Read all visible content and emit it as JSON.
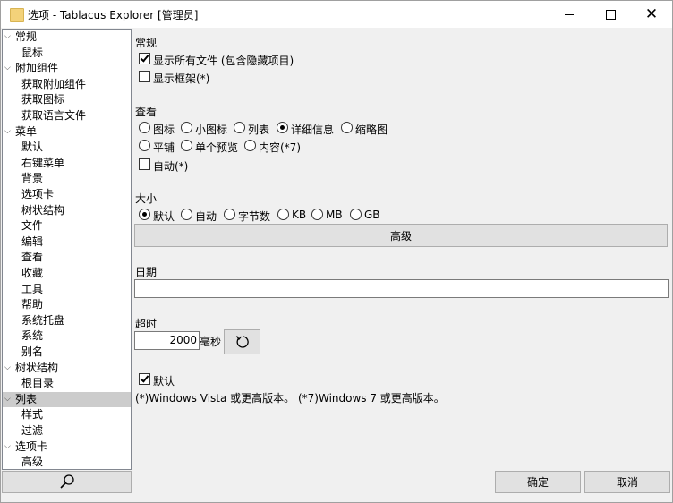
{
  "window": {
    "title": "选项 - Tablacus Explorer [管理员]"
  },
  "tree": {
    "items": [
      {
        "label": "常规",
        "level": 0,
        "expander": "⌵",
        "selected": false
      },
      {
        "label": "鼠标",
        "level": 1,
        "expander": "",
        "selected": false
      },
      {
        "label": "附加组件",
        "level": 0,
        "expander": "⌵",
        "selected": false
      },
      {
        "label": "获取附加组件",
        "level": 1,
        "expander": "",
        "selected": false
      },
      {
        "label": "获取图标",
        "level": 1,
        "expander": "",
        "selected": false
      },
      {
        "label": "获取语言文件",
        "level": 1,
        "expander": "",
        "selected": false
      },
      {
        "label": "菜单",
        "level": 0,
        "expander": "⌵",
        "selected": false
      },
      {
        "label": "默认",
        "level": 1,
        "expander": "",
        "selected": false
      },
      {
        "label": "右键菜单",
        "level": 1,
        "expander": "",
        "selected": false
      },
      {
        "label": "背景",
        "level": 1,
        "expander": "",
        "selected": false
      },
      {
        "label": "选项卡",
        "level": 1,
        "expander": "",
        "selected": false
      },
      {
        "label": "树状结构",
        "level": 1,
        "expander": "",
        "selected": false
      },
      {
        "label": "文件",
        "level": 1,
        "expander": "",
        "selected": false
      },
      {
        "label": "编辑",
        "level": 1,
        "expander": "",
        "selected": false
      },
      {
        "label": "查看",
        "level": 1,
        "expander": "",
        "selected": false
      },
      {
        "label": "收藏",
        "level": 1,
        "expander": "",
        "selected": false
      },
      {
        "label": "工具",
        "level": 1,
        "expander": "",
        "selected": false
      },
      {
        "label": "帮助",
        "level": 1,
        "expander": "",
        "selected": false
      },
      {
        "label": "系统托盘",
        "level": 1,
        "expander": "",
        "selected": false
      },
      {
        "label": "系统",
        "level": 1,
        "expander": "",
        "selected": false
      },
      {
        "label": "别名",
        "level": 1,
        "expander": "",
        "selected": false
      },
      {
        "label": "树状结构",
        "level": 0,
        "expander": "⌵",
        "selected": false
      },
      {
        "label": "根目录",
        "level": 1,
        "expander": "",
        "selected": false
      },
      {
        "label": "列表",
        "level": 0,
        "expander": "⌵",
        "selected": true
      },
      {
        "label": "样式",
        "level": 1,
        "expander": "",
        "selected": false
      },
      {
        "label": "过滤",
        "level": 1,
        "expander": "",
        "selected": false
      },
      {
        "label": "选项卡",
        "level": 0,
        "expander": "⌵",
        "selected": false
      },
      {
        "label": "高级",
        "level": 1,
        "expander": "",
        "selected": false
      }
    ]
  },
  "general": {
    "heading": "常规",
    "show_all_files": {
      "label": "显示所有文件 (包含隐藏项目)",
      "checked": true
    },
    "show_frames": {
      "label": "显示框架(*)",
      "checked": false
    }
  },
  "view": {
    "heading": "查看",
    "options": [
      "图标",
      "小图标",
      "列表",
      "详细信息",
      "缩略图",
      "平铺",
      "单个预览",
      "内容(*7)"
    ],
    "selected": "详细信息",
    "auto": {
      "label": "自动(*)",
      "checked": false
    }
  },
  "size": {
    "heading": "大小",
    "options": [
      "默认",
      "自动",
      "字节数",
      "KB",
      "MB",
      "GB"
    ],
    "selected": "默认",
    "advanced_label": "高级"
  },
  "date": {
    "heading": "日期",
    "value": ""
  },
  "timeout": {
    "heading": "超时",
    "value": "2000",
    "unit": "毫秒",
    "reset_icon": "refresh-icon"
  },
  "default_check": {
    "label": "默认",
    "checked": true
  },
  "note": "(*)Windows Vista 或更高版本。 (*7)Windows 7 或更高版本。",
  "footer": {
    "ok_label": "确定",
    "cancel_label": "取消",
    "search_icon": "search-icon"
  }
}
